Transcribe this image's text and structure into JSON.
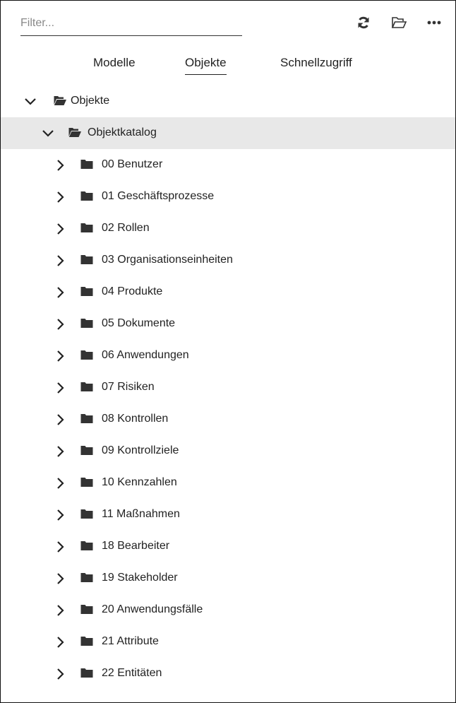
{
  "toolbar": {
    "filter_placeholder": "Filter...",
    "icons": [
      "refresh-icon",
      "folder-open-icon",
      "more-icon"
    ]
  },
  "tabs": [
    {
      "label": "Modelle",
      "active": false
    },
    {
      "label": "Objekte",
      "active": true
    },
    {
      "label": "Schnellzugriff",
      "active": false
    }
  ],
  "tree": {
    "root": {
      "label": "Objekte",
      "expanded": true
    },
    "catalog": {
      "label": "Objektkatalog",
      "expanded": true,
      "selected": true
    },
    "folders": [
      "00 Benutzer",
      "01 Geschäftsprozesse",
      "02 Rollen",
      "03 Organisationseinheiten",
      "04 Produkte",
      "05 Dokumente",
      "06 Anwendungen",
      "07 Risiken",
      "08 Kontrollen",
      "09 Kontrollziele",
      "10 Kennzahlen",
      "11 Maßnahmen",
      "18 Bearbeiter",
      "19 Stakeholder",
      "20 Anwendungsfälle",
      "21 Attribute",
      "22 Entitäten"
    ]
  },
  "colors": {
    "selected_row": "#e8e8e8",
    "icon": "#333333",
    "text": "#222222"
  }
}
